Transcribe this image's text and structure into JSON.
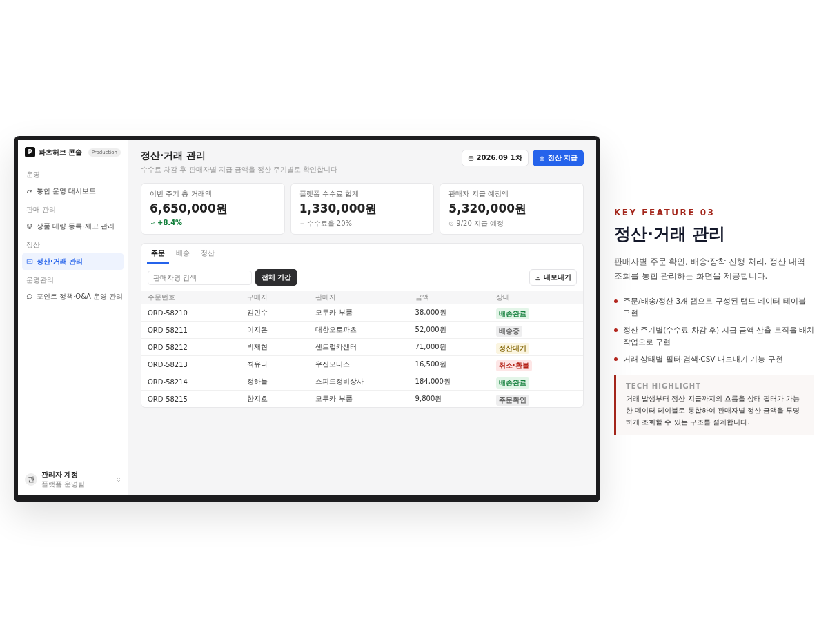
{
  "app": {
    "logo_letter": "P",
    "name": "파츠허브 콘솔",
    "env_badge": "Production"
  },
  "sidebar": {
    "sections": [
      {
        "label": "운영",
        "items": [
          {
            "label": "통합 운영 대시보드",
            "kind": "gauge",
            "selected": false
          }
        ]
      },
      {
        "label": "판매 관리",
        "items": [
          {
            "label": "상품 대량 등록·재고 관리",
            "kind": "layers",
            "selected": false
          }
        ]
      },
      {
        "label": "정산",
        "items": [
          {
            "label": "정산·거래 관리",
            "kind": "receipt",
            "selected": true
          }
        ]
      },
      {
        "label": "운영관리",
        "items": [
          {
            "label": "포인트 정책·Q&A 운영 관리",
            "kind": "chat",
            "selected": false
          }
        ]
      }
    ],
    "account": {
      "avatar": "관",
      "name": "관리자 계정",
      "role": "플랫폼 운영팀"
    }
  },
  "page": {
    "title": "정산·거래 관리",
    "subtitle": "수수료 차감 후 판매자별 지급 금액을 정산 주기별로 확인합니다",
    "period_button": "2026.09 1차",
    "pay_button": "정산 지급"
  },
  "stats": [
    {
      "label": "이번 주기 총 거래액",
      "value": "6,650,000원",
      "note": "+8.4%",
      "kind": "up"
    },
    {
      "label": "플랫폼 수수료 합계",
      "value": "1,330,000원",
      "note": "수수료율 20%",
      "kind": "flat"
    },
    {
      "label": "판매자 지급 예정액",
      "value": "5,320,000원",
      "note": "9/20 지급 예정",
      "kind": "schedule"
    }
  ],
  "tabs": [
    {
      "label": "주문",
      "selected": true
    },
    {
      "label": "배송",
      "selected": false
    },
    {
      "label": "정산",
      "selected": false
    }
  ],
  "search": {
    "placeholder": "판매자명 검색"
  },
  "filter_button": "전체 기간",
  "export_button": "내보내기",
  "table": {
    "columns": [
      "주문번호",
      "구매자",
      "판매자",
      "금액",
      "상태"
    ],
    "rows": [
      {
        "order": "ORD-58210",
        "buyer": "김민수",
        "seller": "모두카 부품",
        "amount": "38,000원",
        "status": "배송완료",
        "kind": "success"
      },
      {
        "order": "ORD-58211",
        "buyer": "이지은",
        "seller": "대한오토파츠",
        "amount": "52,000원",
        "status": "배송중",
        "kind": "neutral"
      },
      {
        "order": "ORD-58212",
        "buyer": "박재현",
        "seller": "센트럴카센터",
        "amount": "71,000원",
        "status": "정산대기",
        "kind": "warning"
      },
      {
        "order": "ORD-58213",
        "buyer": "최유나",
        "seller": "우진모터스",
        "amount": "16,500원",
        "status": "취소·환불",
        "kind": "danger"
      },
      {
        "order": "ORD-58214",
        "buyer": "정하늘",
        "seller": "스피드정비상사",
        "amount": "184,000원",
        "status": "배송완료",
        "kind": "success"
      },
      {
        "order": "ORD-58215",
        "buyer": "한지호",
        "seller": "모두카 부품",
        "amount": "9,800원",
        "status": "주문확인",
        "kind": "neutral"
      }
    ]
  },
  "feature": {
    "eyebrow": "KEY FEATURE 03",
    "title": "정산·거래 관리",
    "description": "판매자별 주문 확인, 배송·장착 진행 처리, 정산 내역 조회를 통합 관리하는 화면을 제공합니다.",
    "bullets": [
      "주문/배송/정산 3개 탭으로 구성된 탭드 데이터 테이블 구현",
      "정산 주기별(수수료 차감 후) 지급 금액 산출 로직을 배치 작업으로 구현",
      "거래 상태별 필터·검색·CSV 내보내기 기능 구현"
    ],
    "highlight": {
      "label": "TECH HIGHLIGHT",
      "text": "거래 발생부터 정산 지급까지의 흐름을 상태 필터가 가능한 데이터 테이블로 통합하여 판매자별 정산 금액을 투명하게 조회할 수 있는 구조를 설계합니다."
    }
  }
}
